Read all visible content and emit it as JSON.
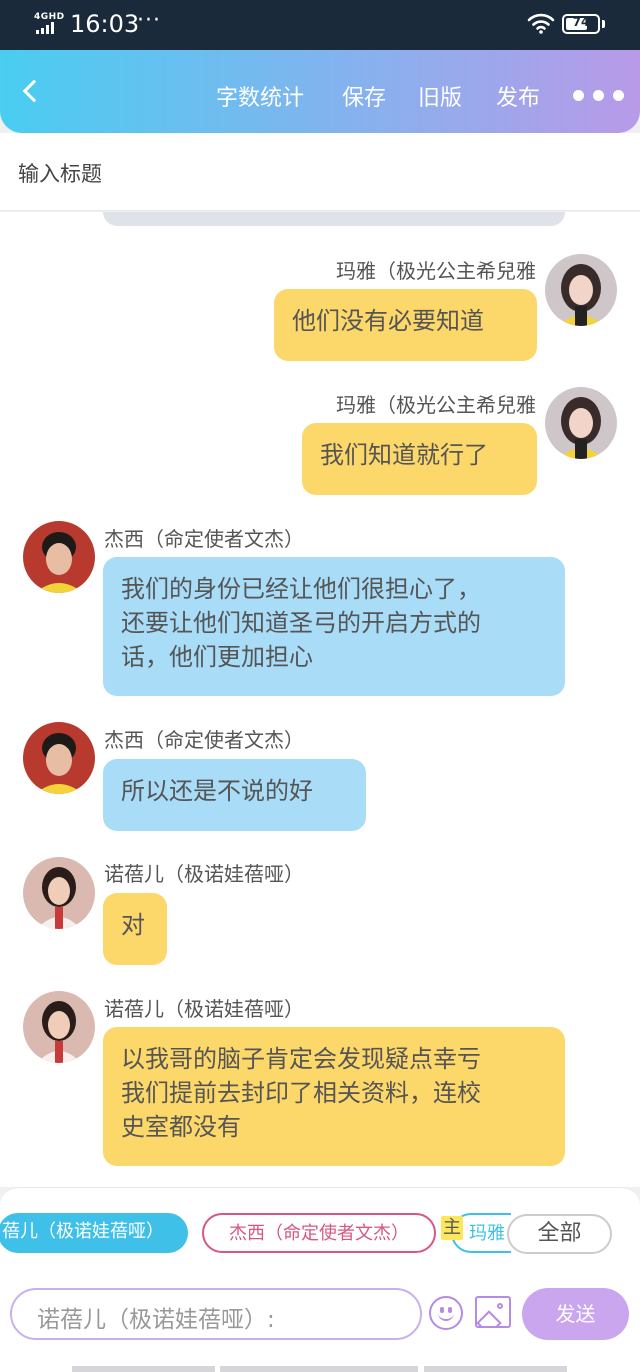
{
  "status_bar": {
    "network": "4GHD",
    "time": "16:03",
    "dots": "···",
    "battery": "74",
    "battery_level": 0.74
  },
  "toolbar": {
    "back_icon": "chevron-left-icon",
    "word_count": "字数统计",
    "save": "保存",
    "old_version": "旧版",
    "publish": "发布",
    "more_icon": "more-dots-icon"
  },
  "title": {
    "placeholder": "输入标题"
  },
  "messages": [
    {
      "side": "right",
      "speaker": "玛雅（极光公主希兒雅",
      "text": "他们没有必要知道",
      "color": "#fcd769"
    },
    {
      "side": "right",
      "speaker": "玛雅（极光公主希兒雅",
      "text": "我们知道就行了",
      "color": "#fcd769"
    },
    {
      "side": "left",
      "speaker": "杰西（命定使者文杰）",
      "lines": [
        "我们的身份已经让他们很担心了，",
        "还要让他们知道圣弓的开启方式的",
        "话，他们更加担心"
      ],
      "color": "#a8dcf7"
    },
    {
      "side": "left",
      "speaker": "杰西（命定使者文杰）",
      "text": "所以还是不说的好",
      "color": "#a8dcf7"
    },
    {
      "side": "left",
      "speaker": "诺蓓儿（极诺娃蓓哑）",
      "text": "对",
      "color": "#fcd769"
    },
    {
      "side": "left",
      "speaker": "诺蓓儿（极诺娃蓓哑）",
      "lines": [
        "以我哥的脑子肯定会发现疑点幸亏",
        "我们提前去封印了相关资料，连校",
        "史室都没有"
      ],
      "color": "#fcd769"
    }
  ],
  "tags": {
    "nuo": "蓓儿（极诺娃蓓哑）",
    "jie": "杰西（命定使者文杰）",
    "zhu": "主",
    "ma": "玛雅",
    "all": "全部"
  },
  "composer": {
    "placeholder": "诺蓓儿（极诺娃蓓哑）:",
    "emoji_icon": "emoji-icon",
    "image_icon": "image-icon",
    "send": "发送"
  }
}
